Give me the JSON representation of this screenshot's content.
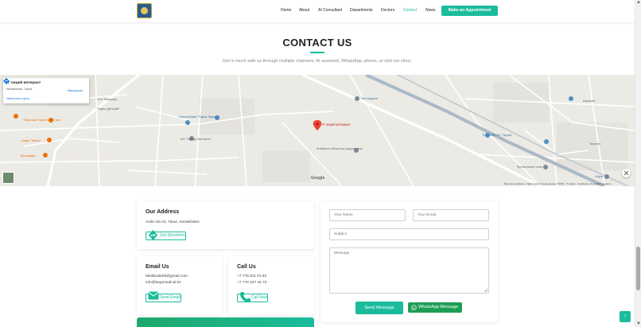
{
  "nav": {
    "items": [
      "Home",
      "About",
      "AI Consultant",
      "Departments",
      "Doctors",
      "Contact",
      "News"
    ],
    "active": "Contact",
    "cta": "Make an Appointment"
  },
  "hero": {
    "title": "CONTACT US",
    "subtitle": "Get in touch with us through multiple channels: AI assistant, WhatsApp, phone, or visit our clinic."
  },
  "map": {
    "card_title": "IT лицей интернат",
    "card_address": "Автовокзал, Тараз",
    "card_link": "Увеличить карту",
    "card_directions": "Маршруты",
    "pin_label": "IT лицей интернат",
    "google": "Google",
    "attribution": "Быстрые клавиши · Картографические данные ©2024 · Условия · Сообщить об ошибке на карте",
    "labels": {
      "biz_bngami": "Biz bngami",
      "tovarpro": "Отс Товарпро",
      "tarazbaby": "\"Тараз Детский\"",
      "sauna": "Салон-баня \"Тараз Жарма\"",
      "kaf_klass": "Кафе \"Класс\"",
      "kosmos": "\"Евразия\" Банкетный зал",
      "malkavan": "Малкаван",
      "zavod": "АО \"Завод Запчасть\"",
      "oblast": "Жамбыл облыстық ауруханасы",
      "too": "ТОО СВС Кх \"Тараз\"",
      "football": "Футбольное поле",
      "kora": "Кора",
      "karasu": "Карасай",
      "koktem": "Коктем"
    }
  },
  "address": {
    "heading": "Our Address",
    "line": "Aulie Ata 31, Taraz, Kazakhstan",
    "button": "Get Directions"
  },
  "email": {
    "heading": "Email Us",
    "lines": [
      "bbekbolat29@gmail.com",
      "info@taupmedical.kz"
    ],
    "button": "Send Email"
  },
  "phone": {
    "heading": "Call Us",
    "lines": [
      "+7 775 811 01 52",
      "+7 778 107 42 72"
    ],
    "button": "Call Now"
  },
  "form": {
    "name_placeholder": "Your Name",
    "email_placeholder": "Your Email",
    "subject_placeholder": "Subject",
    "message_placeholder": "Message",
    "send_label": "Send Message",
    "whatsapp_label": "WhatsApp Message"
  },
  "scroll_top": "↑",
  "colors": {
    "accent": "#1abc9c",
    "whatsapp": "#1e9e55",
    "pin": "#ea4335"
  },
  "icons": [
    "direction-icon",
    "email-icon",
    "phone-icon",
    "whatsapp-icon",
    "map-pin-icon",
    "arrow-up-icon"
  ]
}
